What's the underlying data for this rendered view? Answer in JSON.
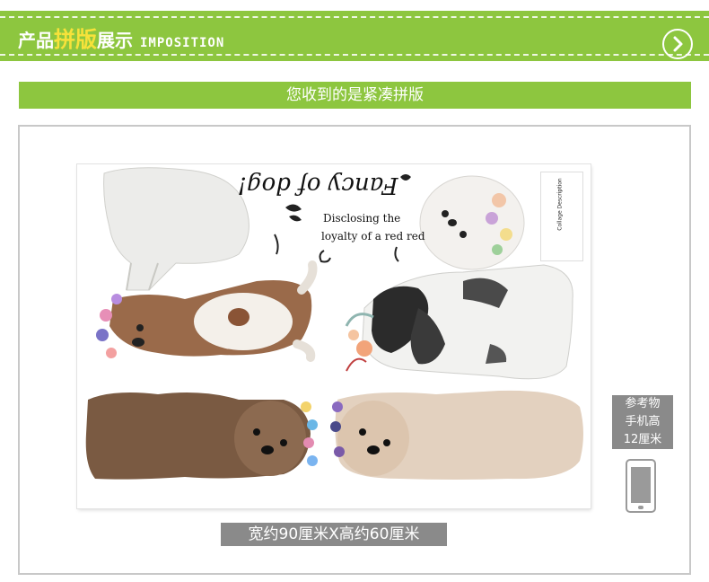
{
  "header": {
    "title_part1": "产品",
    "title_part2": "拼版",
    "title_part3": "展示",
    "title_en": "IMPOSITION"
  },
  "subtitle": "您收到的是紧凑拼版",
  "sheet": {
    "fancy_text": "Fancy of dog!",
    "motto_line1": "Disclosing the",
    "motto_line2": "loyalty of a red red",
    "tag_title": "Collage Description"
  },
  "size_label": "宽约90厘米X高约60厘米",
  "reference": {
    "line1": "参考物",
    "line2": "手机高",
    "line3": "12厘米"
  },
  "colors": {
    "brand_green": "#8dc63f",
    "accent_yellow": "#f7e23a",
    "label_gray": "#8a8a8a"
  }
}
